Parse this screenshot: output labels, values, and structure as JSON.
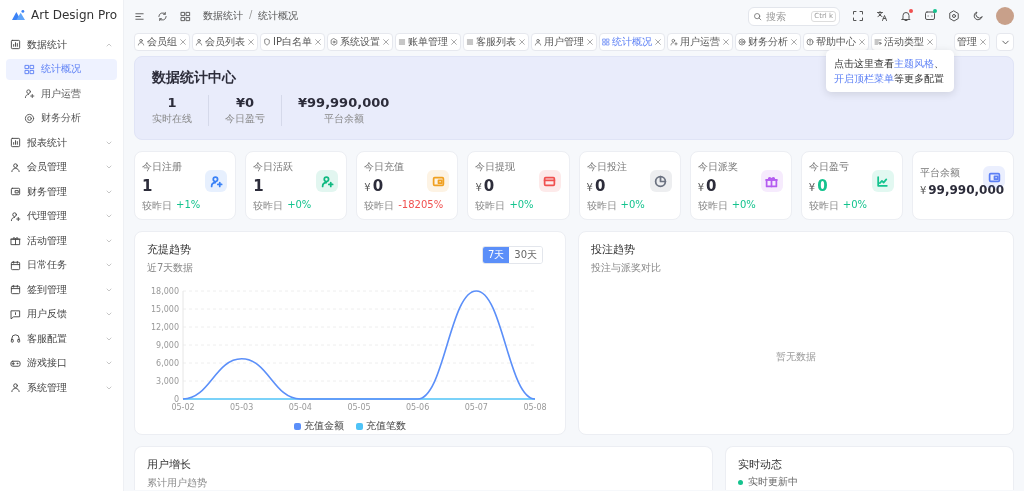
{
  "app": {
    "name": "Art Design Pro"
  },
  "sidebar": {
    "items": [
      {
        "label": "数据统计",
        "expanded": true,
        "children": [
          {
            "label": "统计概况",
            "selected": true
          },
          {
            "label": "用户运营",
            "selected": false
          },
          {
            "label": "财务分析",
            "selected": false
          }
        ]
      },
      {
        "label": "报表统计",
        "expanded": false
      },
      {
        "label": "会员管理",
        "expanded": false
      },
      {
        "label": "财务管理",
        "expanded": false
      },
      {
        "label": "代理管理",
        "expanded": false
      },
      {
        "label": "活动管理",
        "expanded": false
      },
      {
        "label": "日常任务",
        "expanded": false
      },
      {
        "label": "签到管理",
        "expanded": false
      },
      {
        "label": "用户反馈",
        "expanded": false
      },
      {
        "label": "客服配置",
        "expanded": false
      },
      {
        "label": "游戏接口",
        "expanded": false
      },
      {
        "label": "系统管理",
        "expanded": false
      }
    ]
  },
  "header": {
    "breadcrumb": [
      "数据统计",
      "统计概况"
    ],
    "breadcrumb_separator": "/",
    "search": {
      "placeholder": "搜索",
      "shortcut": "Ctrl k"
    },
    "notifications": {
      "unread": true
    },
    "messages": {
      "unread": true
    }
  },
  "tabs": [
    {
      "label": "会员组",
      "selected": false
    },
    {
      "label": "会员列表",
      "selected": false
    },
    {
      "label": "IP白名单",
      "selected": false
    },
    {
      "label": "系统设置",
      "selected": false
    },
    {
      "label": "账单管理",
      "selected": false
    },
    {
      "label": "客服列表",
      "selected": false
    },
    {
      "label": "用户管理",
      "selected": false
    },
    {
      "label": "统计概况",
      "selected": true
    },
    {
      "label": "用户运营",
      "selected": false
    },
    {
      "label": "财务分析",
      "selected": false
    },
    {
      "label": "帮助中心",
      "selected": false
    },
    {
      "label": "活动类型",
      "selected": false
    },
    {
      "label": "管理",
      "selected": false
    }
  ],
  "tooltip": {
    "parts": [
      {
        "text": "点击这里查看",
        "link": false
      },
      {
        "text": "主题风格",
        "link": true
      },
      {
        "text": "、",
        "link": false
      },
      {
        "text": "开启顶栏菜单",
        "link": true
      },
      {
        "text": "等更多配置",
        "link": false
      }
    ]
  },
  "banner": {
    "title": "数据统计中心",
    "stats": [
      {
        "value": "1",
        "label": "实时在线"
      },
      {
        "value": "¥0",
        "label": "今日盈亏"
      },
      {
        "value": "¥99,990,000",
        "label": "平台余额"
      }
    ]
  },
  "stat_cards": [
    {
      "kind": "stat",
      "title": "今日注册",
      "value": "1",
      "compare": "较昨日",
      "change": "+1%",
      "declining": false,
      "highlight": false,
      "color": "#3b82f6"
    },
    {
      "kind": "stat",
      "title": "今日活跃",
      "value": "1",
      "compare": "较昨日",
      "change": "+0%",
      "declining": false,
      "highlight": false,
      "color": "#10b981"
    },
    {
      "kind": "stat",
      "title": "今日充值",
      "prefix": "¥",
      "value": "0",
      "compare": "较昨日",
      "change": "-18205%",
      "declining": true,
      "highlight": false,
      "color": "#f0a020"
    },
    {
      "kind": "stat",
      "title": "今日提现",
      "prefix": "¥",
      "value": "0",
      "compare": "较昨日",
      "change": "+0%",
      "declining": false,
      "highlight": false,
      "color": "#f0504f"
    },
    {
      "kind": "stat",
      "title": "今日投注",
      "prefix": "¥",
      "value": "0",
      "compare": "较昨日",
      "change": "+0%",
      "declining": false,
      "highlight": false,
      "color": "#6b7280"
    },
    {
      "kind": "stat",
      "title": "今日派奖",
      "prefix": "¥",
      "value": "0",
      "compare": "较昨日",
      "change": "+0%",
      "declining": false,
      "highlight": false,
      "color": "#b45cf0"
    },
    {
      "kind": "stat",
      "title": "今日盈亏",
      "prefix": "¥",
      "value": "0",
      "compare": "较昨日",
      "change": "+0%",
      "declining": false,
      "highlight": true,
      "color": "#14c38e"
    },
    {
      "kind": "balance",
      "title": "平台余额",
      "prefix": "¥",
      "value": "99,990,000",
      "highlight": false,
      "color": "#5b7ff5"
    }
  ],
  "recharge_chart": {
    "title": "充提趋势",
    "subtitle": "近7天数据",
    "ranges": [
      {
        "label": "7天",
        "selected": true
      },
      {
        "label": "30天",
        "selected": false
      }
    ],
    "chart_data": {
      "type": "line",
      "categories": [
        "05-02",
        "05-03",
        "05-04",
        "05-05",
        "05-06",
        "05-07",
        "05-08"
      ],
      "ylim": [
        0,
        18000
      ],
      "grid": true,
      "yticks": [
        0,
        {
          "value": 3000,
          "label": "3,000"
        },
        {
          "value": 6000,
          "label": "6,000"
        },
        {
          "value": 9000,
          "label": "9,000"
        },
        {
          "value": 12000,
          "label": "12,000"
        },
        {
          "value": 15000,
          "label": "15,000"
        },
        {
          "value": 18000,
          "label": "18,000"
        }
      ],
      "series": [
        {
          "name": "充值金额",
          "color": "#5b8ff9",
          "values": [
            0,
            6700,
            0,
            0,
            0,
            18000,
            0
          ]
        },
        {
          "name": "充值笔数",
          "color": "#4fc3f7",
          "values": [
            0,
            0,
            0,
            0,
            0,
            0,
            0
          ]
        }
      ]
    }
  },
  "bet_chart": {
    "title": "投注趋势",
    "subtitle": "投注与派奖对比",
    "empty_text": "暂无数据"
  },
  "user_growth": {
    "title": "用户增长",
    "subtitle": "累计用户趋势"
  },
  "live_feed": {
    "title": "实时动态",
    "status": "实时更新中"
  }
}
